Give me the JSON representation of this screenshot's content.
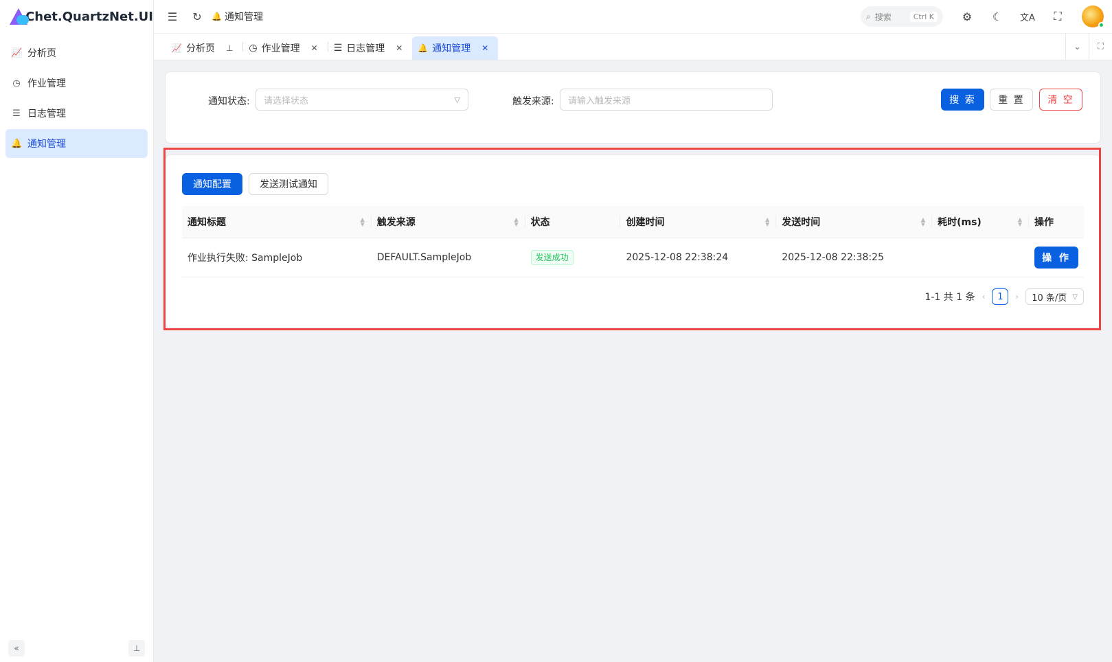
{
  "app": {
    "title": "Chet.QuartzNet.UI"
  },
  "sidebar": {
    "items": [
      {
        "label": "分析页",
        "icon": "chart-icon"
      },
      {
        "label": "作业管理",
        "icon": "clock-icon"
      },
      {
        "label": "日志管理",
        "icon": "list-icon"
      },
      {
        "label": "通知管理",
        "icon": "bell-icon",
        "active": true
      }
    ]
  },
  "header": {
    "breadcrumb": "通知管理",
    "search": {
      "placeholder": "搜索",
      "shortcut": "Ctrl K"
    }
  },
  "tabs": [
    {
      "label": "分析页",
      "icon": "chart-icon"
    },
    {
      "label": "作业管理",
      "icon": "clock-icon"
    },
    {
      "label": "日志管理",
      "icon": "list-icon"
    },
    {
      "label": "通知管理",
      "icon": "bell-icon",
      "active": true
    }
  ],
  "filters": {
    "status_label": "通知状态:",
    "status_placeholder": "请选择状态",
    "source_label": "触发来源:",
    "source_placeholder": "请输入触发来源",
    "search_button": "搜 索",
    "reset_button": "重 置",
    "clear_button": "清 空"
  },
  "toolbar": {
    "config_button": "通知配置",
    "test_button": "发送测试通知"
  },
  "table": {
    "columns": [
      "通知标题",
      "触发来源",
      "状态",
      "创建时间",
      "发送时间",
      "耗时(ms)",
      "操作"
    ],
    "rows": [
      {
        "title": "作业执行失败: SampleJob",
        "source": "DEFAULT.SampleJob",
        "status": "发送成功",
        "created": "2025-12-08 22:38:24",
        "sent": "2025-12-08 22:38:25",
        "duration": "",
        "action": "操 作"
      }
    ]
  },
  "pagination": {
    "summary": "1-1 共 1 条",
    "current": "1",
    "page_size": "10 条/页"
  },
  "colors": {
    "primary": "#0960e0",
    "danger": "#ef4444",
    "success": "#22c55e",
    "active_bg": "#dbeafe"
  }
}
